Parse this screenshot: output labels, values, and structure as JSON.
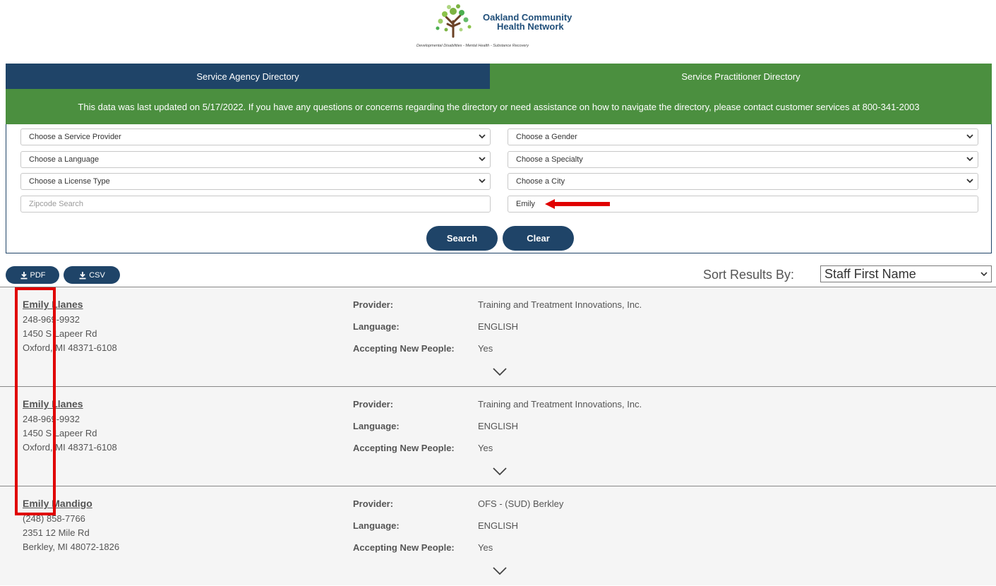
{
  "logo": {
    "name_line1": "Oakland Community",
    "name_line2": "Health Network",
    "tagline": "Developmental Disabilities - Mental Health - Substance Recovery"
  },
  "tabs": [
    {
      "label": "Service Agency Directory"
    },
    {
      "label": "Service Practitioner Directory"
    }
  ],
  "notice": "This data was last updated on 5/17/2022. If you have any questions or concerns regarding the directory or need assistance on how to navigate the directory, please contact customer services at 800-341-2003",
  "filters": {
    "service_provider": "Choose a Service Provider",
    "gender": "Choose a Gender",
    "language": "Choose a Language",
    "specialty": "Choose a Specialty",
    "license_type": "Choose a License Type",
    "city": "Choose a City",
    "zipcode_placeholder": "Zipcode Search",
    "name_value": "Emily"
  },
  "buttons": {
    "search": "Search",
    "clear": "Clear"
  },
  "toolbar": {
    "pdf": "PDF",
    "csv": "CSV",
    "sort_label": "Sort Results By:",
    "sort_value": "Staff First Name"
  },
  "labels": {
    "provider": "Provider:",
    "language": "Language:",
    "accepting": "Accepting New People:"
  },
  "results": [
    {
      "name": "Emily Llanes",
      "phone": "248-969-9932",
      "address1": "1450 S Lapeer Rd",
      "address2": "Oxford, MI 48371-6108",
      "provider": "Training and Treatment Innovations, Inc.",
      "language": "ENGLISH",
      "accepting": "Yes"
    },
    {
      "name": "Emily Llanes",
      "phone": "248-969-9932",
      "address1": "1450 S Lapeer Rd",
      "address2": "Oxford, MI 48371-6108",
      "provider": "Training and Treatment Innovations, Inc.",
      "language": "ENGLISH",
      "accepting": "Yes"
    },
    {
      "name": "Emily Mandigo",
      "phone": "(248) 858-7766",
      "address1": "2351 12 Mile Rd",
      "address2": "Berkley, MI 48072-1826",
      "provider": "OFS - (SUD) Berkley",
      "language": "ENGLISH",
      "accepting": "Yes"
    }
  ],
  "colors": {
    "navy": "#1f4468",
    "green": "#4b8f3f",
    "annotation_red": "#e00000"
  }
}
